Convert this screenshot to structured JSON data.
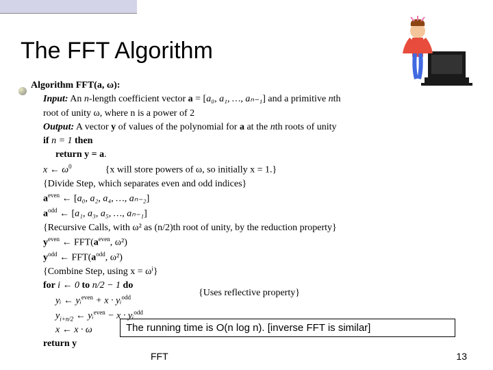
{
  "title": "The FFT Algorithm",
  "algo": {
    "header_pre": "Algorithm FFT(",
    "header_args": "a, ω",
    "header_post": "):",
    "input_label": "Input:",
    "input_text_a": " An ",
    "input_n": "n",
    "input_text_b": "-length coefficient vector ",
    "input_vec": "a",
    "input_text_c": " = [",
    "input_coeffs": "a₀, a₁, …, aₙ₋₁",
    "input_text_d": "] and a primitive ",
    "input_nth": "n",
    "input_text_e": "th",
    "input_line2": "root of unity ω, where n is a power of 2",
    "output_label": "Output:",
    "output_text_a": " A vector ",
    "output_y": "y",
    "output_text_b": " of values of the polynomial for ",
    "output_a": "a",
    "output_text_c": " at the ",
    "output_n": "n",
    "output_text_d": "th roots of unity",
    "if_pre": "if ",
    "if_cond": "n = 1",
    "if_then": " then",
    "return1_pre": "return ",
    "return1_eq": "y = a",
    "return1_dot": ".",
    "xinit_lhs": "x ← ω",
    "xinit_sup": "0",
    "xinit_comment": "{x will store powers of ω, so initially x = 1.}",
    "divide_comment": "{Divide Step, which separates even and odd indices}",
    "aeven_lhs": "a",
    "aeven_sup": "even",
    "aeven_arrow": " ← [",
    "aeven_list": "a₀, a₂, a₄, …, aₙ₋₂",
    "aeven_close": "]",
    "aodd_lhs": "a",
    "aodd_sup": "odd",
    "aodd_arrow": " ← [",
    "aodd_list": "a₁, a₃, a₅, …, aₙ₋₁",
    "aodd_close": "]",
    "recursive_comment": "{Recursive Calls, with ω² as (n/2)th root of unity, by the reduction property}",
    "yeven_lhs": "y",
    "yeven_sup": "even",
    "yeven_arrow": " ← FFT(",
    "yeven_arg_a": "a",
    "yeven_arg_sup": "even",
    "yeven_arg_rest": ", ω²)",
    "yodd_lhs": "y",
    "yodd_sup": "odd",
    "yodd_arrow": " ← FFT(",
    "yodd_arg_a": "a",
    "yodd_arg_sup": "odd",
    "yodd_arg_rest": ", ω²)",
    "combine_comment": "{Combine Step, using x = ωⁱ}",
    "for_pre": "for ",
    "for_range": "i ← 0 ",
    "for_to": "to",
    "for_end": " n/2 − 1 ",
    "for_do": "do",
    "yi_line": "yᵢ ← yᵢ",
    "yi_sup": "even",
    "yi_plus": " + x · yᵢ",
    "yi_sup2": "odd",
    "yin2_lhs": "y",
    "yin2_sub": "i+n/2",
    "yin2_arrow": " ← yᵢ",
    "yin2_sup": "even",
    "yin2_minus": " − x · yᵢ",
    "yin2_sup2": "odd",
    "reflective_comment": "{Uses reflective property}",
    "xupdate": "x ← x · ω",
    "return2_pre": "return ",
    "return2_y": "y"
  },
  "runtime_box": "The running time is O(n log n). [inverse FFT is similar]",
  "footer_left": "FFT",
  "footer_right": "13"
}
